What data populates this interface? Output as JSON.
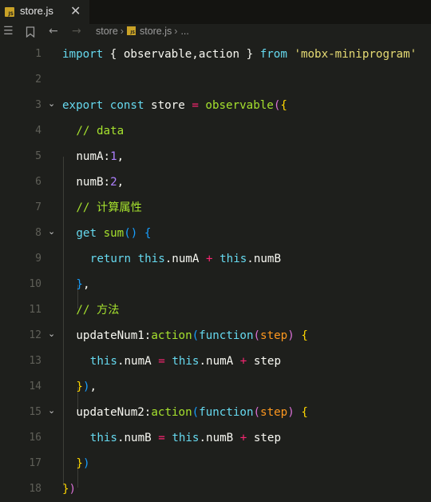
{
  "tab": {
    "label": "store.js",
    "badge": "JS"
  },
  "breadcrumb": {
    "folder": "store",
    "file": "store.js",
    "tail": "..."
  },
  "lines": [
    {
      "n": "1",
      "fold": false,
      "indent": 0,
      "tokens": [
        [
          "kw",
          "import"
        ],
        [
          "p",
          " { observable,action } "
        ],
        [
          "kw",
          "from"
        ],
        [
          "p",
          " "
        ],
        [
          "str",
          "'mobx-miniprogram'"
        ]
      ]
    },
    {
      "n": "2",
      "fold": false,
      "indent": 0,
      "tokens": []
    },
    {
      "n": "3",
      "fold": true,
      "indent": 0,
      "tokens": [
        [
          "kw",
          "export"
        ],
        [
          "p",
          " "
        ],
        [
          "kw",
          "const"
        ],
        [
          "p",
          " store "
        ],
        [
          "op",
          "="
        ],
        [
          "p",
          " "
        ],
        [
          "fn",
          "observable"
        ],
        [
          "b1",
          "("
        ],
        [
          "b2",
          "{"
        ]
      ]
    },
    {
      "n": "4",
      "fold": false,
      "indent": 1,
      "tokens": [
        [
          "cm2",
          "// data"
        ]
      ]
    },
    {
      "n": "5",
      "fold": false,
      "indent": 1,
      "tokens": [
        [
          "p",
          "numA:"
        ],
        [
          "num",
          "1"
        ],
        [
          "p",
          ","
        ]
      ]
    },
    {
      "n": "6",
      "fold": false,
      "indent": 1,
      "tokens": [
        [
          "p",
          "numB:"
        ],
        [
          "num",
          "2"
        ],
        [
          "p",
          ","
        ]
      ]
    },
    {
      "n": "7",
      "fold": false,
      "indent": 1,
      "tokens": [
        [
          "cm2",
          "// 计算属性"
        ]
      ]
    },
    {
      "n": "8",
      "fold": true,
      "indent": 1,
      "tokens": [
        [
          "kw",
          "get"
        ],
        [
          "p",
          " "
        ],
        [
          "fn",
          "sum"
        ],
        [
          "b3",
          "()"
        ],
        [
          "p",
          " "
        ],
        [
          "b3",
          "{"
        ]
      ]
    },
    {
      "n": "9",
      "fold": false,
      "indent": 2,
      "tokens": [
        [
          "kw",
          "return"
        ],
        [
          "p",
          " "
        ],
        [
          "this",
          "this"
        ],
        [
          "p",
          ".numA "
        ],
        [
          "op",
          "+"
        ],
        [
          "p",
          " "
        ],
        [
          "this",
          "this"
        ],
        [
          "p",
          ".numB"
        ]
      ]
    },
    {
      "n": "10",
      "fold": false,
      "indent": 1,
      "tokens": [
        [
          "b3",
          "}"
        ],
        [
          "p",
          ","
        ]
      ]
    },
    {
      "n": "11",
      "fold": false,
      "indent": 1,
      "tokens": [
        [
          "cm2",
          "// 方法"
        ]
      ]
    },
    {
      "n": "12",
      "fold": true,
      "indent": 1,
      "tokens": [
        [
          "p",
          "updateNum1:"
        ],
        [
          "fn",
          "action"
        ],
        [
          "b3",
          "("
        ],
        [
          "kw",
          "function"
        ],
        [
          "b1",
          "("
        ],
        [
          "prm",
          "step"
        ],
        [
          "b1",
          ")"
        ],
        [
          "p",
          " "
        ],
        [
          "b2",
          "{"
        ]
      ]
    },
    {
      "n": "13",
      "fold": false,
      "indent": 2,
      "tokens": [
        [
          "this",
          "this"
        ],
        [
          "p",
          ".numA "
        ],
        [
          "op",
          "="
        ],
        [
          "p",
          " "
        ],
        [
          "this",
          "this"
        ],
        [
          "p",
          ".numA "
        ],
        [
          "op",
          "+"
        ],
        [
          "p",
          " step"
        ]
      ]
    },
    {
      "n": "14",
      "fold": false,
      "indent": 1,
      "tokens": [
        [
          "b2",
          "}"
        ],
        [
          "b3",
          ")"
        ],
        [
          "p",
          ","
        ]
      ]
    },
    {
      "n": "15",
      "fold": true,
      "indent": 1,
      "tokens": [
        [
          "p",
          "updateNum2:"
        ],
        [
          "fn",
          "action"
        ],
        [
          "b3",
          "("
        ],
        [
          "kw",
          "function"
        ],
        [
          "b1",
          "("
        ],
        [
          "prm",
          "step"
        ],
        [
          "b1",
          ")"
        ],
        [
          "p",
          " "
        ],
        [
          "b2",
          "{"
        ]
      ]
    },
    {
      "n": "16",
      "fold": false,
      "indent": 2,
      "tokens": [
        [
          "this",
          "this"
        ],
        [
          "p",
          ".numB "
        ],
        [
          "op",
          "="
        ],
        [
          "p",
          " "
        ],
        [
          "this",
          "this"
        ],
        [
          "p",
          ".numB "
        ],
        [
          "op",
          "+"
        ],
        [
          "p",
          " step"
        ]
      ]
    },
    {
      "n": "17",
      "fold": false,
      "indent": 1,
      "tokens": [
        [
          "b2",
          "}"
        ],
        [
          "b3",
          ")"
        ]
      ]
    },
    {
      "n": "18",
      "fold": false,
      "indent": 0,
      "tokens": [
        [
          "b2",
          "}"
        ],
        [
          "b1",
          ")"
        ]
      ]
    }
  ]
}
